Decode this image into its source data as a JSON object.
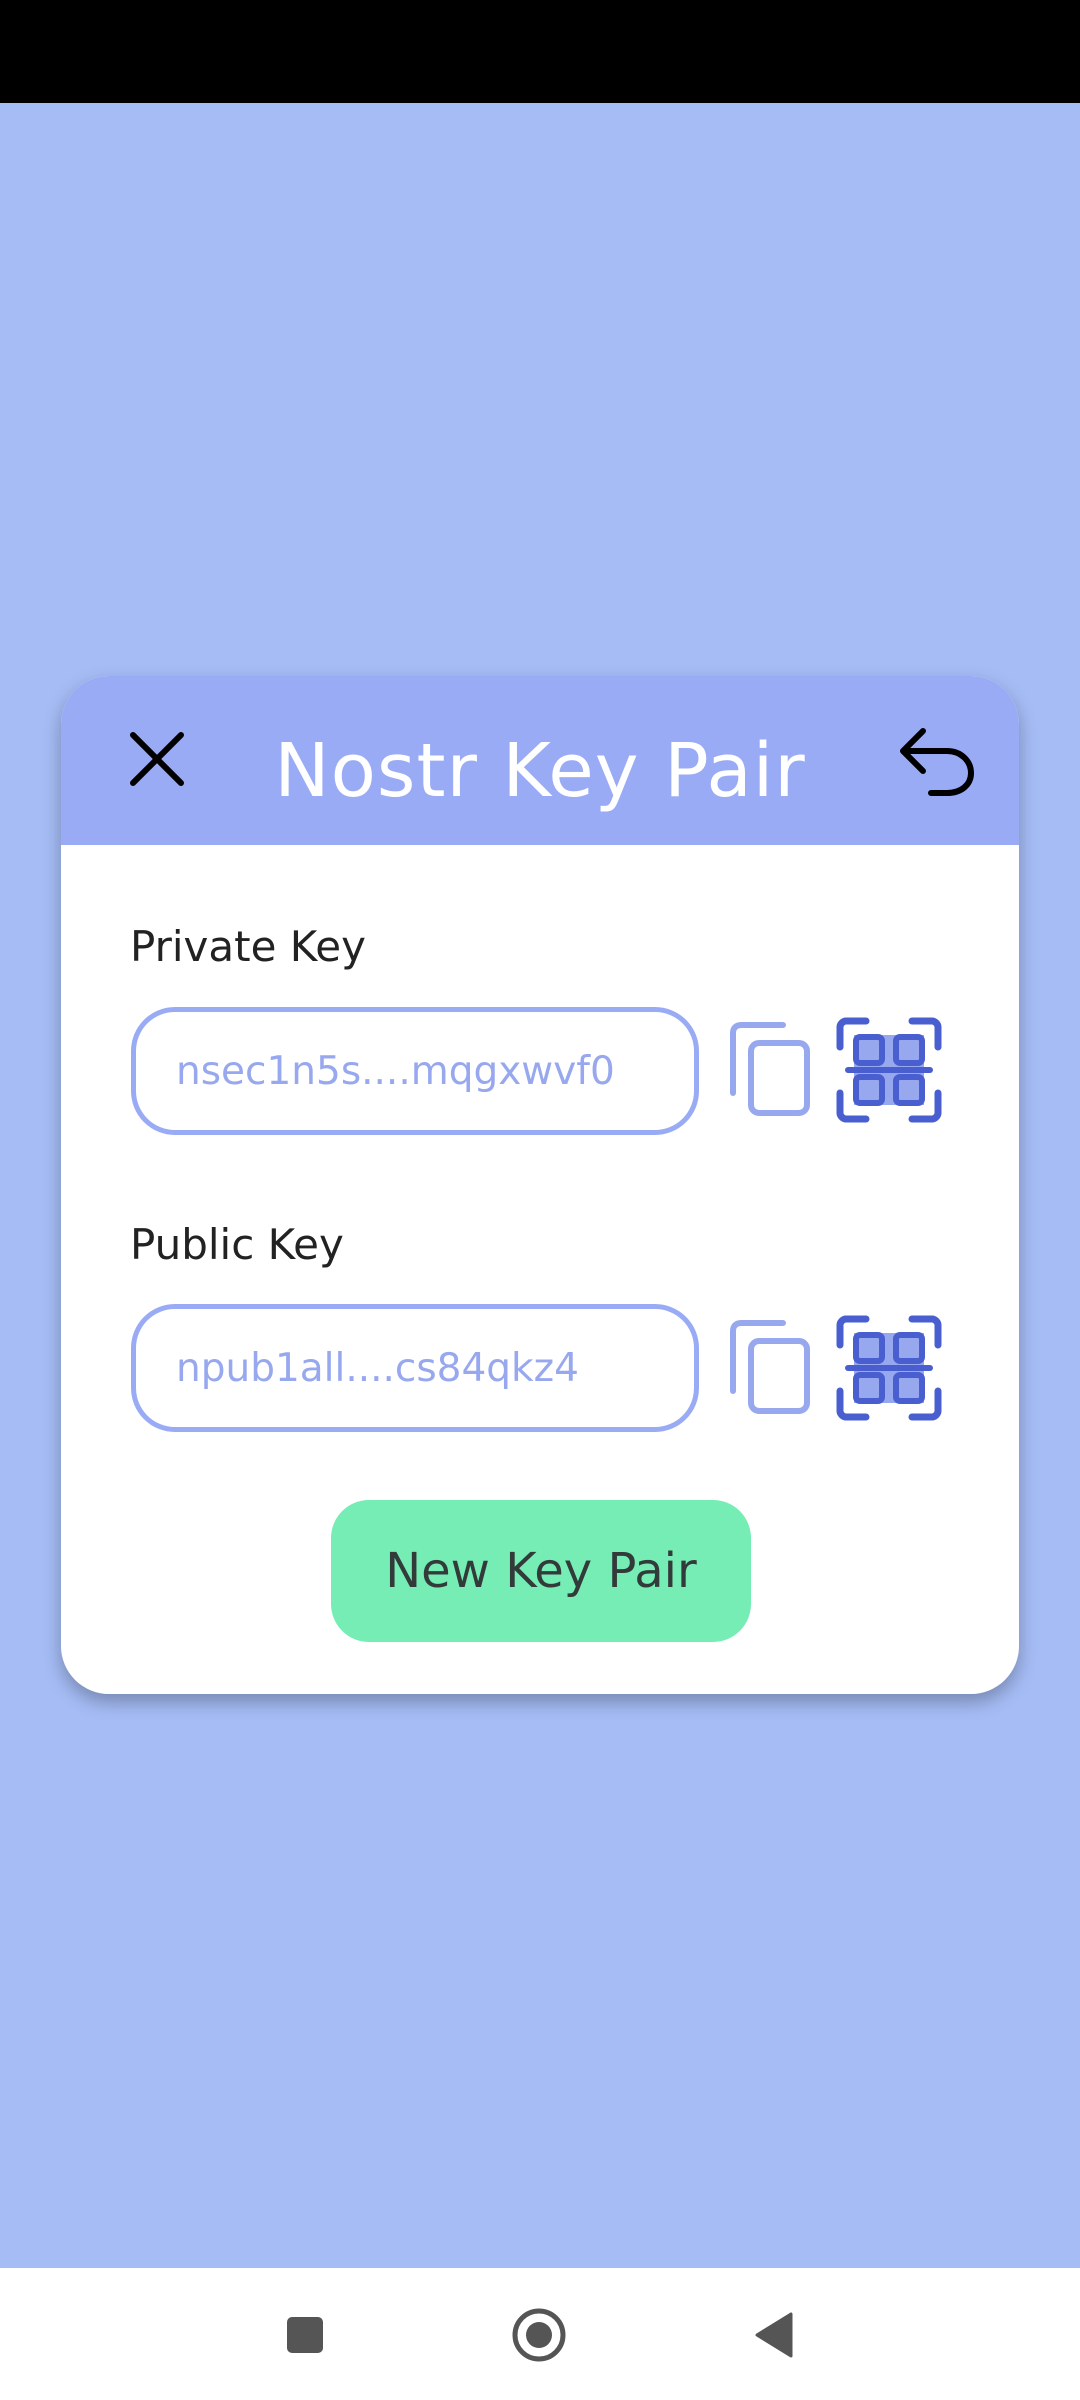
{
  "dialog": {
    "title": "Nostr Key Pair",
    "close_icon": "close-icon",
    "undo_icon": "undo-icon"
  },
  "private_key": {
    "label": "Private Key",
    "value": "nsec1n5s....mqgxwvf0",
    "copy_icon": "copy-icon",
    "qr_icon": "qr-code-icon"
  },
  "public_key": {
    "label": "Public Key",
    "value": "npub1all....cs84qkz4",
    "copy_icon": "copy-icon",
    "qr_icon": "qr-code-icon"
  },
  "actions": {
    "new_key_pair_label": "New Key Pair"
  },
  "navigation": {
    "recents_icon": "square-icon",
    "home_icon": "circle-icon",
    "back_icon": "triangle-back-icon"
  },
  "colors": {
    "background": "#a5bcf5",
    "header": "#9aabf6",
    "accent_button": "#76edb5",
    "qr_icon": "#4a5fcf",
    "copy_icon": "#98a8ef"
  }
}
